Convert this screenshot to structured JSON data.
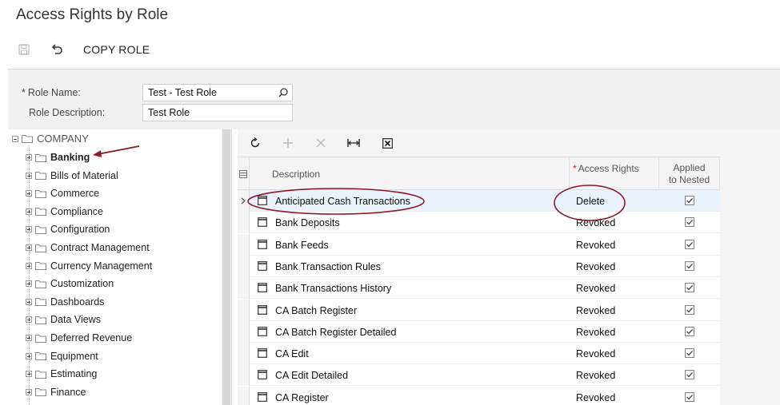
{
  "page": {
    "title": "Access Rights by Role"
  },
  "toolbar": {
    "save_icon": "save-icon",
    "undo_icon": "undo-icon",
    "copy_role_label": "COPY ROLE"
  },
  "form": {
    "role_name_label": "Role Name:",
    "role_name_value": "Test - Test Role",
    "role_description_label": "Role Description:",
    "role_description_value": "Test Role"
  },
  "tree": {
    "root": "COMPANY",
    "items": [
      "Banking",
      "Bills of Material",
      "Commerce",
      "Compliance",
      "Configuration",
      "Contract Management",
      "Currency Management",
      "Customization",
      "Dashboards",
      "Data Views",
      "Deferred Revenue",
      "Equipment",
      "Estimating",
      "Finance"
    ],
    "selected": "Banking"
  },
  "grid": {
    "headers": {
      "description": "Description",
      "access_rights": "Access Rights",
      "applied_line1": "Applied",
      "applied_line2": "to Nested"
    },
    "rows": [
      {
        "description": "Anticipated Cash Transactions",
        "access": "Delete",
        "applied": true
      },
      {
        "description": "Bank Deposits",
        "access": "Revoked",
        "applied": true
      },
      {
        "description": "Bank Feeds",
        "access": "Revoked",
        "applied": true
      },
      {
        "description": "Bank Transaction Rules",
        "access": "Revoked",
        "applied": true
      },
      {
        "description": "Bank Transactions History",
        "access": "Revoked",
        "applied": true
      },
      {
        "description": "CA Batch Register",
        "access": "Revoked",
        "applied": true
      },
      {
        "description": "CA Batch Register Detailed",
        "access": "Revoked",
        "applied": true
      },
      {
        "description": "CA Edit",
        "access": "Revoked",
        "applied": true
      },
      {
        "description": "CA Edit Detailed",
        "access": "Revoked",
        "applied": true
      },
      {
        "description": "CA Register",
        "access": "Revoked",
        "applied": true
      }
    ]
  },
  "colors": {
    "annotation": "#8b1a2b",
    "active_row": "#eaf3fb"
  }
}
